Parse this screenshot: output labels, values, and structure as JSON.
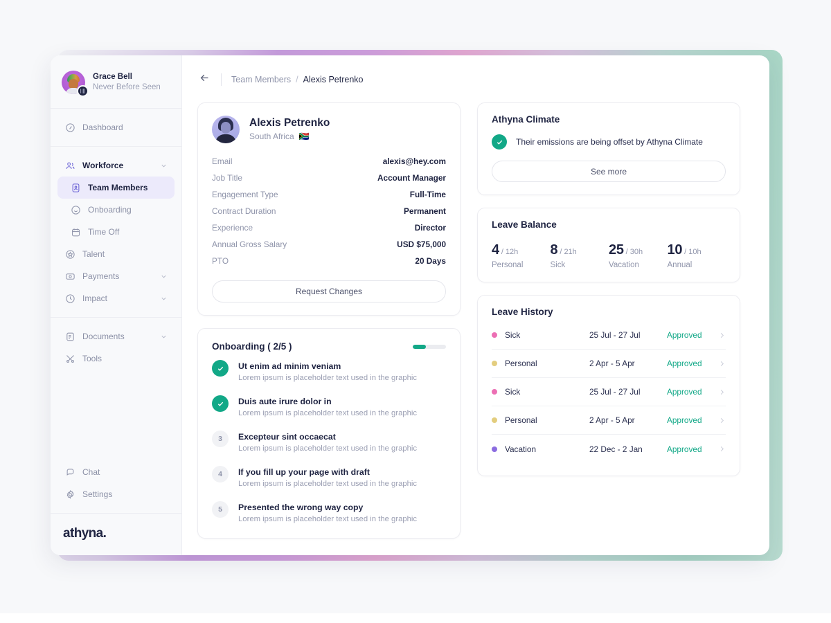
{
  "sidebar": {
    "user": {
      "name": "Grace Bell",
      "subtitle": "Never Before Seen"
    },
    "nav_primary": [
      {
        "label": "Dashboard",
        "icon": "dashboard-icon"
      }
    ],
    "nav_workforce": {
      "label": "Workforce",
      "icon": "people-icon",
      "children": [
        {
          "label": "Team Members",
          "icon": "member-card-icon",
          "active": true
        },
        {
          "label": "Onboarding",
          "icon": "smiley-icon",
          "active": false
        },
        {
          "label": "Time Off",
          "icon": "calendar-icon",
          "active": false
        }
      ]
    },
    "nav_secondary": [
      {
        "label": "Talent",
        "icon": "star-badge-icon",
        "chevron": false
      },
      {
        "label": "Payments",
        "icon": "payment-icon",
        "chevron": true
      },
      {
        "label": "Impact",
        "icon": "impact-icon",
        "chevron": true
      }
    ],
    "nav_tertiary": [
      {
        "label": "Documents",
        "icon": "document-icon",
        "chevron": true
      },
      {
        "label": "Tools",
        "icon": "tools-icon",
        "chevron": false
      }
    ],
    "nav_footer": [
      {
        "label": "Chat",
        "icon": "chat-icon"
      },
      {
        "label": "Settings",
        "icon": "gear-icon"
      }
    ],
    "logo": {
      "text": "athyna",
      "dot": "."
    }
  },
  "topbar": {
    "back_icon": "arrow-left-icon",
    "breadcrumb_parent": "Team Members",
    "breadcrumb_sep": "/",
    "breadcrumb_current": "Alexis Petrenko"
  },
  "profile": {
    "name": "Alexis Petrenko",
    "location": "South Africa",
    "flag": "🇿🇦",
    "fields": [
      {
        "key": "Email",
        "value": "alexis@hey.com"
      },
      {
        "key": "Job Title",
        "value": "Account Manager"
      },
      {
        "key": "Engagement Type",
        "value": "Full-Time"
      },
      {
        "key": "Contract Duration",
        "value": "Permanent"
      },
      {
        "key": "Experience",
        "value": "Director"
      },
      {
        "key": "Annual Gross Salary",
        "value": "USD $75,000"
      },
      {
        "key": "PTO",
        "value": "20 Days"
      }
    ],
    "request_changes_label": "Request Changes"
  },
  "onboarding": {
    "title": "Onboarding ( 2/5 )",
    "progress_percent": 40,
    "steps": [
      {
        "marker": "check",
        "done": true,
        "title": "Ut enim ad minim veniam",
        "desc": "Lorem ipsum is placeholder text used in the graphic"
      },
      {
        "marker": "check",
        "done": true,
        "title": "Duis aute irure dolor in",
        "desc": "Lorem ipsum is placeholder text used in the graphic"
      },
      {
        "marker": "3",
        "done": false,
        "title": "Excepteur sint occaecat",
        "desc": "Lorem ipsum is placeholder text used in the graphic"
      },
      {
        "marker": "4",
        "done": false,
        "title": "If you fill up your page with draft",
        "desc": "Lorem ipsum is placeholder text used in the graphic"
      },
      {
        "marker": "5",
        "done": false,
        "title": "Presented the wrong way copy",
        "desc": "Lorem ipsum is placeholder text used in the graphic"
      }
    ]
  },
  "climate": {
    "title": "Athyna Climate",
    "message": "Their emissions are being offset by Athyna Climate",
    "see_more_label": "See more",
    "accent_color": "#12a887"
  },
  "leave_balance": {
    "title": "Leave Balance",
    "items": [
      {
        "value": "4",
        "total": "/ 12h",
        "label": "Personal"
      },
      {
        "value": "8",
        "total": "/ 21h",
        "label": "Sick"
      },
      {
        "value": "25",
        "total": "/ 30h",
        "label": "Vacation"
      },
      {
        "value": "10",
        "total": "/ 10h",
        "label": "Annual"
      }
    ]
  },
  "leave_history": {
    "title": "Leave History",
    "rows": [
      {
        "type": "Sick",
        "dates": "25 Jul - 27 Jul",
        "status": "Approved",
        "color": "#ec6fb4"
      },
      {
        "type": "Personal",
        "dates": "2 Apr - 5 Apr",
        "status": "Approved",
        "color": "#e3cd7e"
      },
      {
        "type": "Sick",
        "dates": "25 Jul - 27 Jul",
        "status": "Approved",
        "color": "#ec6fb4"
      },
      {
        "type": "Personal",
        "dates": "2 Apr - 5 Apr",
        "status": "Approved",
        "color": "#e3cd7e"
      },
      {
        "type": "Vacation",
        "dates": "22 Dec - 2 Jan",
        "status": "Approved",
        "color": "#8b6ce0"
      }
    ]
  }
}
